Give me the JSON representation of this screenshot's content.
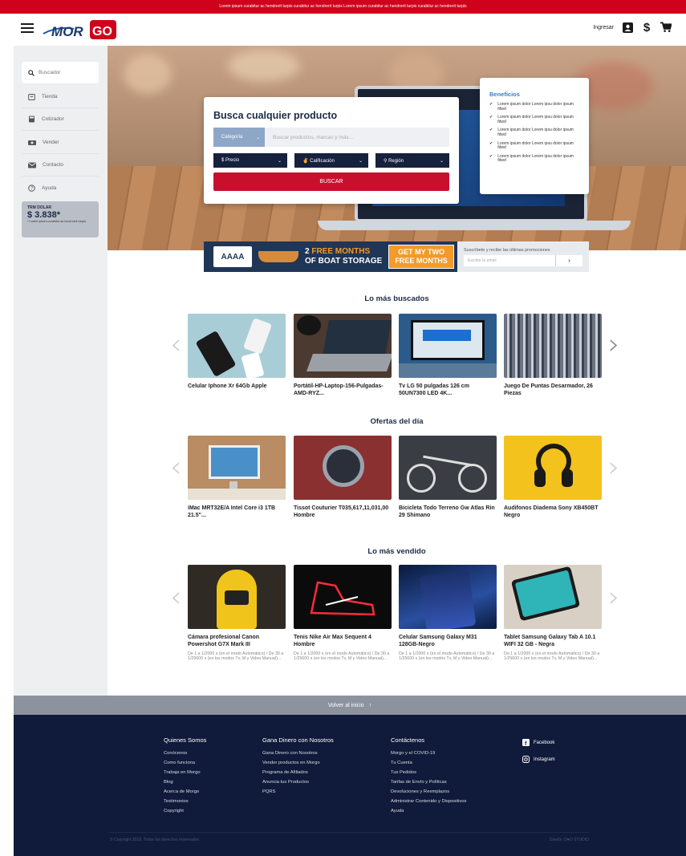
{
  "topbar": {
    "text": "Lorem ipsum curabitur ac hendrerit turpis curabitur ac hendrerit turpis   Lorem ipsum curabitur ac hendrerit turpis curabitur ac hendrerit turpis"
  },
  "header": {
    "login": "Ingresar"
  },
  "sidebar": {
    "search": "Buscador",
    "items": [
      {
        "label": "Tienda",
        "icon": "shopping-bag-icon"
      },
      {
        "label": "Cotizador",
        "icon": "calculator-icon"
      },
      {
        "label": "Vender",
        "icon": "cash-icon"
      },
      {
        "label": "Contacto",
        "icon": "mail-icon"
      },
      {
        "label": "Ayuda",
        "icon": "help-circle-icon"
      }
    ],
    "trm": {
      "title": "TRM DOLAR",
      "value": "$ 3.838*",
      "note": "* Lorem ipsum curabitur ac hend rerit turpis"
    }
  },
  "search": {
    "title": "Busca cualquier producto",
    "category": "Categoría",
    "placeholder": "Buscar productos, marcas y más...",
    "price": "$ Precio",
    "rating": "Calificación",
    "region": "Región",
    "button": "BUSCAR"
  },
  "benefits": {
    "title": "Beneficios",
    "items": [
      "Lorem ipsum dolor Lorem ipsu dolor ipsum fdwd",
      "Lorem ipsum dolor Lorem ipsu dolor ipsum fdwd",
      "Lorem ipsum dolor Lorem ipsu dolor ipsum fdwd",
      "Lorem ipsum dolor Lorem ipsu dolor ipsum fdwd",
      "Lorem ipsum dolor Lorem ipsu dolor ipsum fdwd"
    ]
  },
  "banner": {
    "brand": "AAAA",
    "line1a": "2 ",
    "line1b": "FREE MONTHS",
    "line2": "OF BOAT STORAGE",
    "cta1": "GET MY TWO",
    "cta2": "FREE MONTHS",
    "subscribe": "Suscríbete y recibe las últimas promociones",
    "email_placeholder": "Escribe tu email"
  },
  "sections": [
    {
      "title": "Lo más buscados",
      "products": [
        {
          "name": "Celular Iphone Xr 64Gb Apple",
          "desc": ""
        },
        {
          "name": "Portátil-HP-Laptop-156-Pulgadas-AMD-RYZ...",
          "desc": ""
        },
        {
          "name": "Tv LG 50 pulgadas 126 cm 50UN7300 LED 4K...",
          "desc": ""
        },
        {
          "name": "Juego De Puntas Desarmador, 26 Piezas",
          "desc": ""
        }
      ]
    },
    {
      "title": "Ofertas del día",
      "products": [
        {
          "name": "iMac MRT32E/A Intel Core i3 1TB 21.5\"...",
          "desc": ""
        },
        {
          "name": "Tissot Couturier T035,617,11,031,00 Hombre",
          "desc": ""
        },
        {
          "name": "Bicicleta Todo Terreno Gw Atlas Rin 29 Shimano",
          "desc": ""
        },
        {
          "name": "Audifonos Diadema Sony XB450BT Negro",
          "desc": ""
        }
      ]
    },
    {
      "title": "Lo más vendido",
      "products": [
        {
          "name": "Cámara profesional Canon Powershot G7X Mark III",
          "desc": "De 1 a 1/2000 s (en el modo Automático) / De 30 a 1/25600 s (en los modos Tv, M y Video Manual)..."
        },
        {
          "name": "Tenis Nike Air Max Sequent 4 Hombre",
          "desc": "De 1 a 1/2000 s (en el modo Automático) / De 30 a 1/25600 s (en los modos Tv, M y Video Manual)..."
        },
        {
          "name": "Celular Samsung Galaxy M31 128GB-Negro",
          "desc": "De 1 a 1/2000 s (en el modo Automático) / De 30 a 1/25600 s (en los modos Tv, M y Video Manual)..."
        },
        {
          "name": "Tablet Samsung Galaxy Tab A 10.1 WIFI 32 GB - Negra",
          "desc": "De 1 a 1/2000 s (en el modo Automático) / De 30 a 1/25600 s (en los modos Tv, M y Video Manual)..."
        }
      ]
    }
  ],
  "backtop": "Volver al inicio",
  "footer": {
    "cols": [
      {
        "title": "Quienes Somos",
        "links": [
          "Conócenos",
          "Como funciona",
          "Trabaja en Morgo",
          "Blog",
          "Acerca de Morgo",
          "Testimonios",
          "Copyright"
        ]
      },
      {
        "title": "Gana Dinero con Nosotros",
        "links": [
          "Gana Dinero con Nosotros",
          "Vender productos en Morgo",
          "Programa de Afiliados",
          "Anuncia tus Productos",
          "PQRS"
        ]
      },
      {
        "title": "Contáctenos",
        "links": [
          "Morgo y el COVID-19",
          "Tu Cuenta",
          "Tus Pedidos",
          "Tarifas de Envío y Políticas",
          "Devoluciones y Reemplazos",
          "Administrar Contenido y Dispositivos",
          "Ayuda"
        ]
      }
    ],
    "social": [
      "Facebook",
      "Instagram"
    ],
    "copyright": "© Copyright 2018. Todos los derechos reservados.",
    "design": "Diseño: D♥O STUDIO"
  },
  "colors": {
    "brand_red": "#d0021b",
    "navy": "#101a3a",
    "accent_blue": "#3b7ec7"
  }
}
